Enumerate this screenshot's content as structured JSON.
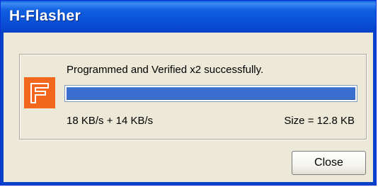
{
  "window": {
    "title": "H-Flasher"
  },
  "status": {
    "message": "Programmed and Verified x2 successfully.",
    "progress_fraction": 1.0,
    "speed": "18 KB/s  +  14 KB/s",
    "size": "Size = 12.8 KB"
  },
  "buttons": {
    "close_label": "Close"
  },
  "colors": {
    "titlebar": "#0a4fd6",
    "logo": "#f2671c",
    "progress_fill": "#3a6fcf",
    "dialog_bg": "#ece9d8"
  },
  "icons": {
    "logo": "hflasher-logo-icon"
  }
}
